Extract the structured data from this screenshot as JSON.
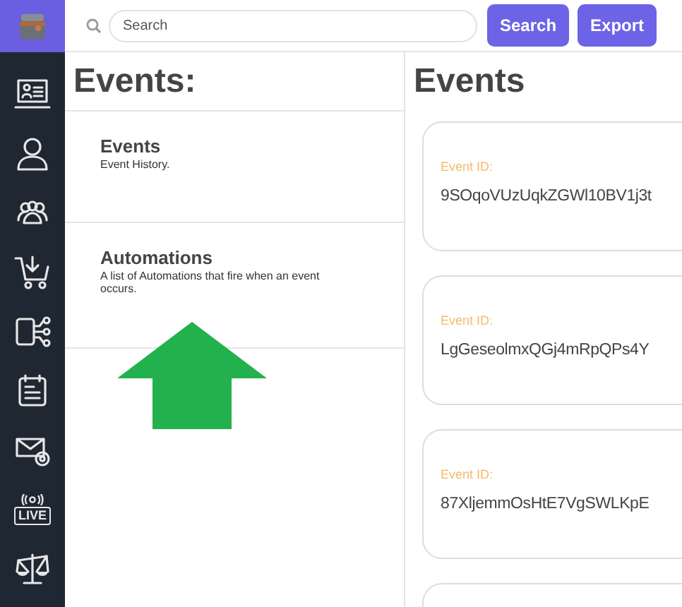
{
  "sidebar": {
    "live_label": "LIVE"
  },
  "toolbar": {
    "search": {
      "placeholder": "Search"
    },
    "buttons": [
      "Search",
      "Export"
    ]
  },
  "left_panel": {
    "title": "Events:",
    "items": [
      {
        "title": "Events",
        "description": "Event History."
      },
      {
        "title": "Automations",
        "description": "A list of Automations that fire when an event occurs."
      }
    ]
  },
  "right_panel": {
    "title": "Events",
    "cards": [
      {
        "label": "Event ID:",
        "value": "9SOqoVUzUqkZGWl10BV1j3t"
      },
      {
        "label": "Event ID:",
        "value": "LgGeseolmxQGj4mRpQPs4Y"
      },
      {
        "label": "Event ID:",
        "value": "87XljemmOsHtE7VgSWLKpE"
      },
      {
        "kind": "cut_off"
      }
    ]
  }
}
